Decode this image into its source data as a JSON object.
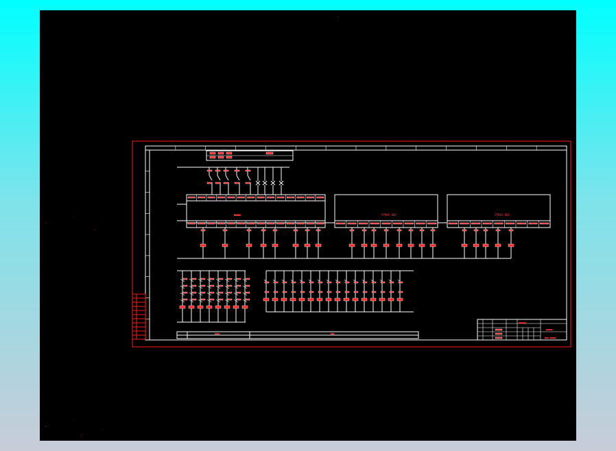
{
  "colors": {
    "background_gradient_top": "#00ffff",
    "background_gradient_bottom": "#c8ccd8",
    "model_space": "#000000",
    "frame": "#ff1a1a",
    "wiring": "#ffffff",
    "components": "#ff2a2a"
  },
  "title_block": {
    "project_line": "■■■■■■",
    "drawing_title": "■■■■■",
    "drawing_no": "■■■-■■■■■"
  },
  "modules": [
    {
      "label": "■■■■"
    },
    {
      "label": "CPM1A-8ED"
    },
    {
      "label": "CPM1A-8ED"
    }
  ],
  "bottom_table": {
    "cell_a": "■■■■",
    "cell_b": "■■■"
  }
}
